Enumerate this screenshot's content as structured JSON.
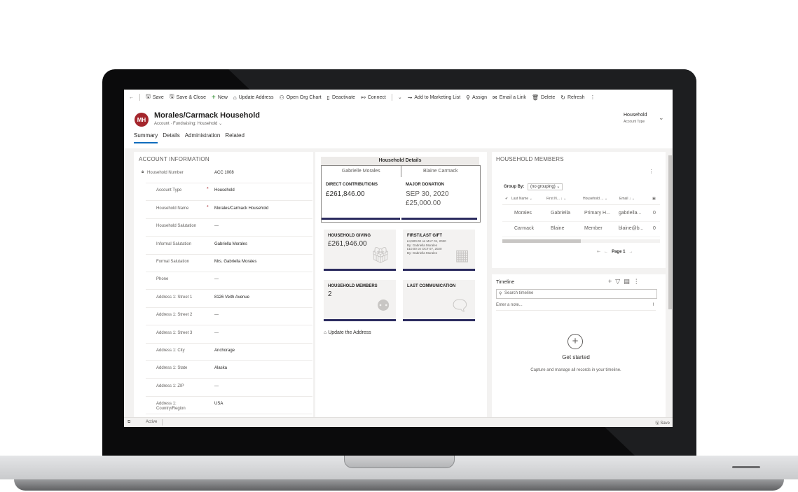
{
  "toolbar": {
    "back_icon": "back-arrow-icon",
    "items": [
      {
        "label": "Save",
        "icon": "save-icon"
      },
      {
        "label": "Save & Close",
        "icon": "save-close-icon"
      },
      {
        "label": "New",
        "icon": "plus-icon"
      },
      {
        "label": "Update Address",
        "icon": "home-icon"
      },
      {
        "label": "Open Org Chart",
        "icon": "org-chart-icon"
      },
      {
        "label": "Deactivate",
        "icon": "deactivate-icon"
      },
      {
        "label": "Connect",
        "icon": "connect-icon"
      },
      {
        "label": "Add to Marketing List",
        "icon": "marketing-list-icon"
      },
      {
        "label": "Assign",
        "icon": "assign-icon"
      },
      {
        "label": "Email a Link",
        "icon": "email-icon"
      },
      {
        "label": "Delete",
        "icon": "delete-icon"
      },
      {
        "label": "Refresh",
        "icon": "refresh-icon"
      }
    ]
  },
  "header": {
    "avatar": "MH",
    "avatar_color": "#a4262c",
    "title": "Morales/Carmack Household",
    "subtitle": "Account  ·  Fundraising: Household",
    "field_value": "Household",
    "field_label": "Account Type"
  },
  "tabs": [
    "Summary",
    "Details",
    "Administration",
    "Related"
  ],
  "account_info": {
    "title": "ACCOUNT INFORMATION",
    "fields": [
      {
        "label": "Household Number",
        "value": "ACC 1008",
        "required": false,
        "locked": true
      },
      {
        "label": "Account Type",
        "value": "Household",
        "required": true
      },
      {
        "label": "Household Name",
        "value": "Morales/Carmack Household",
        "required": true
      },
      {
        "label": "Household Salutation",
        "value": "---",
        "required": false
      },
      {
        "label": "Informal Salutation",
        "value": "Gabriella Morales",
        "required": false
      },
      {
        "label": "Formal Salutation",
        "value": "Mrs. Gabriella Morales",
        "required": false
      },
      {
        "label": "Phone",
        "value": "---",
        "required": false
      },
      {
        "label": "Address 1: Street 1",
        "value": "8126 Veith Avenue",
        "required": false
      },
      {
        "label": "Address 1: Street 2",
        "value": "---",
        "required": false
      },
      {
        "label": "Address 1: Street 3",
        "value": "---",
        "required": false
      },
      {
        "label": "Address 1: City",
        "value": "Anchorage",
        "required": false
      },
      {
        "label": "Address 1: State",
        "value": "Alaska",
        "required": false
      },
      {
        "label": "Address 1: ZIP",
        "value": "---",
        "required": false
      },
      {
        "label": "Address 1: Country/Region",
        "value": "USA",
        "required": false
      }
    ]
  },
  "household_details": {
    "title": "Household Details",
    "members_tabs": [
      "Gabrielle Morales",
      "Blaine Carmack"
    ],
    "direct_contributions": {
      "label": "DIRECT CONTRIBUTIONS",
      "value": "£261,846.00"
    },
    "major_donation": {
      "label": "MAJOR DONATION",
      "date": "SEP 30, 2020",
      "amount": "£25,000.00"
    },
    "household_giving": {
      "label": "HOUSEHOLD GIVING",
      "value": "£261,946.00"
    },
    "first_last_gift": {
      "label": "FIRST/LAST GIFT",
      "lines": [
        "£4,500.00 on MAY 01, 2020",
        "By: Gabriella Morales",
        "£10.00 on OCT 07, 2020",
        "By: Gabriella Morales"
      ]
    },
    "household_members": {
      "label": "HOUSEHOLD MEMBERS",
      "value": "2"
    },
    "last_communication": {
      "label": "LAST COMMUNICATION",
      "value": ""
    },
    "update_link": "Update the Address"
  },
  "members_grid": {
    "title": "HOUSEHOLD MEMBERS",
    "group_by_label": "Group By:",
    "group_by_value": "(no grouping)",
    "columns": [
      "Last Name",
      "First N...",
      "Household ...",
      "Email"
    ],
    "rows": [
      [
        "Morales",
        "Gabriella",
        "Primary H...",
        "gabriella...",
        "0"
      ],
      [
        "Carmack",
        "Blaine",
        "Member",
        "blaine@b...",
        "0"
      ]
    ],
    "page": "Page 1"
  },
  "timeline": {
    "title": "Timeline",
    "search_placeholder": "Search timeline",
    "note_placeholder": "Enter a note...",
    "empty_title": "Get started",
    "empty_text": "Capture and manage all records in your timeline."
  },
  "status": {
    "state": "Active",
    "save": "Save"
  }
}
